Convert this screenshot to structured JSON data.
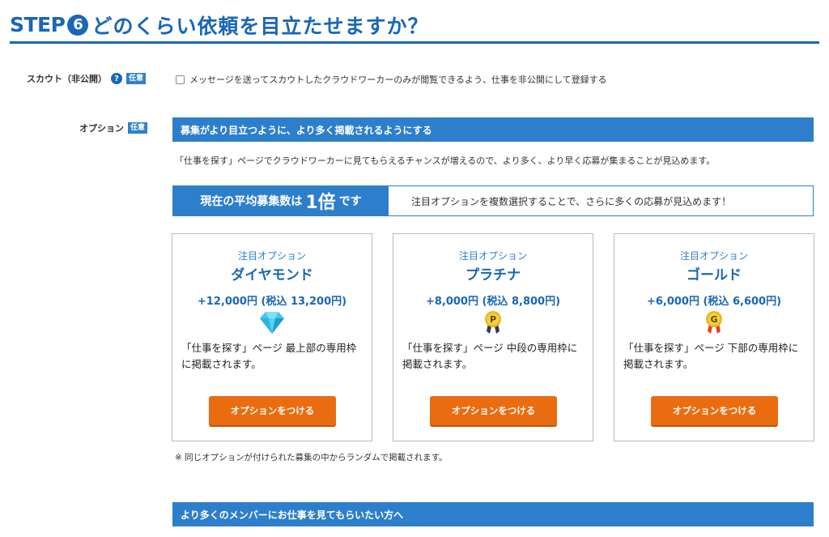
{
  "header": {
    "step_word": "STEP",
    "step_number": "6",
    "title": "どのくらい依頼を目立たせますか？"
  },
  "scout": {
    "label": "スカウト（非公開）",
    "help": "?",
    "badge": "任意",
    "checkbox_label": "メッセージを送ってスカウトしたクラウドワーカーのみが閲覧できるよう、仕事を非公開にして登録する"
  },
  "option": {
    "label": "オプション",
    "badge": "任意",
    "bar_title": "募集がより目立つように、より多く掲載されるようにする",
    "description": "「仕事を探す」ページでクラウドワーカーに見てもらえるチャンスが増えるので、より多く、より早く応募が集まることが見込めます。",
    "avg_prefix": "現在の平均募集数は",
    "avg_value": "1倍",
    "avg_suffix": "です",
    "avg_note": "注目オプションを複数選択することで、さらに多くの応募が見込めます！",
    "cards": [
      {
        "sub": "注目オプション",
        "name": "ダイヤモンド",
        "price": "+12,000円 (税込 13,200円)",
        "icon": "diamond-icon",
        "body": "「仕事を探す」ページ 最上部の専用枠に掲載されます。",
        "button": "オプションをつける"
      },
      {
        "sub": "注目オプション",
        "name": "プラチナ",
        "price": "+8,000円 (税込 8,800円)",
        "icon": "platinum-medal-icon",
        "icon_letter": "P",
        "body": "「仕事を探す」ページ 中段の専用枠に掲載されます。",
        "button": "オプションをつける"
      },
      {
        "sub": "注目オプション",
        "name": "ゴールド",
        "price": "+6,000円 (税込 6,600円)",
        "icon": "gold-medal-icon",
        "icon_letter": "G",
        "body": "「仕事を探す」ページ 下部の専用枠に掲載されます。",
        "button": "オプションをつける"
      }
    ],
    "note": "※ 同じオプションが付けられた募集の中からランダムで掲載されます。"
  },
  "more": {
    "bar_title": "より多くのメンバーにお仕事を見てもらいたい方へ"
  },
  "colors": {
    "primary_blue": "#1a66b8",
    "bar_blue": "#2d7fcb",
    "button_orange": "#ea6c10"
  }
}
